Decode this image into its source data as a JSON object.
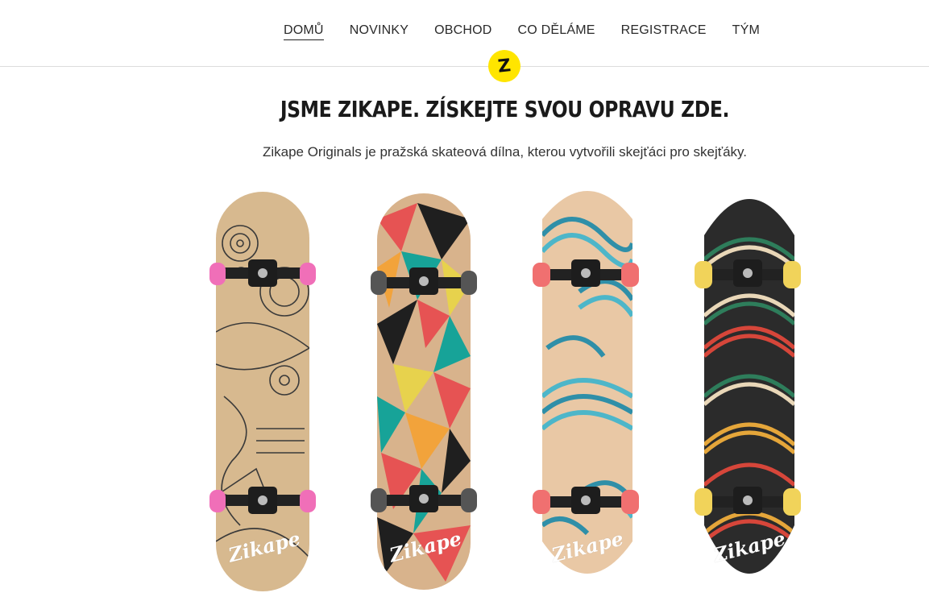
{
  "nav": {
    "items": [
      "DOMŮ",
      "NOVINKY",
      "OBCHOD",
      "CO DĚLÁME",
      "REGISTRACE",
      "TÝM"
    ],
    "active_index": 0
  },
  "logo": {
    "letter": "Z",
    "color": "#ffe500"
  },
  "hero": {
    "headline": "JSME ZIKAPE. ZÍSKEJTE SVOU OPRAVU ZDE.",
    "subtitle": "Zikape Originals je pražská skateová dílna, kterou vytvořili skejťáci pro skejťáky."
  },
  "boards": [
    {
      "brand": "Zikape",
      "design": "doodle",
      "deck_color": "#d7b98f",
      "wheel_color": "#f06fb8"
    },
    {
      "brand": "Zikape",
      "design": "triangles",
      "deck_color": "#d8b38c",
      "wheel_color": "#555555"
    },
    {
      "brand": "Zikape",
      "design": "waves",
      "deck_color": "#e9c8a5",
      "wheel_color": "#f07070"
    },
    {
      "brand": "Zikape",
      "design": "hills",
      "deck_color": "#2b2b2b",
      "wheel_color": "#f1d35a"
    }
  ]
}
